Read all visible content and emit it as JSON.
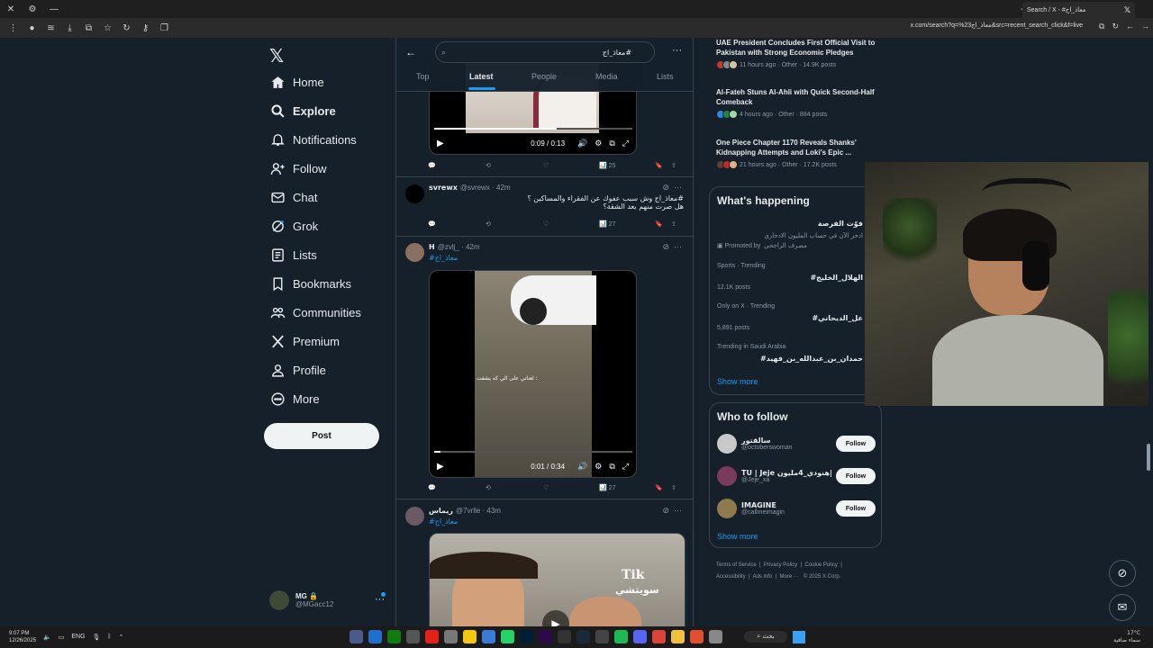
{
  "browser": {
    "tab_title": "Search / X - #معاذ_اج",
    "url": "x.com/search?q=%23معاذ_اج&src=recent_search_click&f=live"
  },
  "nav": {
    "items": [
      {
        "label": "Home"
      },
      {
        "label": "Explore"
      },
      {
        "label": "Notifications"
      },
      {
        "label": "Follow"
      },
      {
        "label": "Chat"
      },
      {
        "label": "Grok"
      },
      {
        "label": "Lists"
      },
      {
        "label": "Bookmarks"
      },
      {
        "label": "Communities"
      },
      {
        "label": "Premium"
      },
      {
        "label": "Profile"
      },
      {
        "label": "More"
      }
    ],
    "post_label": "Post",
    "account": {
      "name": "MG 🔒",
      "handle": "@MGacc12"
    }
  },
  "search": {
    "query": "#معاذ_اج",
    "tabs": [
      "Top",
      "Latest",
      "People",
      "Media",
      "Lists"
    ],
    "active_tab": "Latest"
  },
  "tweets": {
    "t0": {
      "time": "0:09 / 0:13",
      "views": "25"
    },
    "t1": {
      "name": "svrewx",
      "handle": "@svrewx",
      "time": "· 42m",
      "line1": "#معاذ_اج وش سبب عفوك عن الفقراء والمساكين ؟",
      "line2": "هل صرت منهم بعد الشقة؟",
      "views": "27"
    },
    "t2": {
      "name": "H",
      "handle": "@zvlj_",
      "time": "· 42m",
      "text": "#معاذ_اج",
      "video_time": "0:01 / 0:34",
      "video_caption": "لعناتي على الي كه يشفت :",
      "views": "27",
      "video_progress": 0.03
    },
    "t3": {
      "name": "ريماس",
      "handle": "@7vrlle",
      "time": "· 43m",
      "text": "#معاذ_اج",
      "overlay1": "Tik",
      "overlay2": "سويتشي"
    }
  },
  "right": {
    "news": [
      {
        "title": "UAE President Concludes First Official Visit to Pakistan with Strong Economic Pledges",
        "meta": "11 hours ago · Other · 14.9K posts"
      },
      {
        "title": "Al-Fateh Stuns Al-Ahli with Quick Second-Half Comeback",
        "meta": "4 hours ago · Other · 884 posts"
      },
      {
        "title": "One Piece Chapter 1170 Reveals Shanks' Kidnapping Attempts and Loki's Epic ...",
        "meta": "21 hours ago · Other · 17.2K posts"
      }
    ],
    "happening": {
      "title": "What's happening",
      "promo_name": "فوّت الفرصة",
      "promo_sub": "ادخر الآن في حساب المليون الادخاري",
      "promo_by": "Promoted by",
      "promo_brand": "مصرف الراجحي",
      "trends": [
        {
          "context": "Sports · Trending",
          "name": "#الهلال_الخليج",
          "posts": "12.1K posts"
        },
        {
          "context": "Only on X · Trending",
          "name": "#عل_الديحاني",
          "posts": "5,891 posts"
        },
        {
          "context": "Trending in Saudi Arabia",
          "name": "#حمدان_بن_عبدالله_بن_فهيد",
          "posts": ""
        }
      ],
      "show_more": "Show more"
    },
    "who_to_follow": {
      "title": "Who to follow",
      "people": [
        {
          "name": "سالقتور",
          "handle": "@octoberswoman"
        },
        {
          "name": "TU | Jeje هنودي_4مليون|",
          "handle": "@Jeje_xa"
        },
        {
          "name": "IMAGINE",
          "handle": "@callmeimagin"
        }
      ],
      "follow_label": "Follow",
      "show_more": "Show more"
    },
    "footer": [
      "Terms of Service",
      "Privacy Policy",
      "Cookie Policy",
      "Accessibility",
      "Ads info",
      "More ···",
      "© 2025 X Corp."
    ]
  },
  "taskbar": {
    "time": "9:07 PM",
    "date": "12/26/2025",
    "lang": "ENG",
    "search": "بحث",
    "weather_temp": "17°C",
    "weather_desc": "سماء صافية"
  },
  "colors": {
    "bg": "#15202b",
    "accent": "#1d9bf0",
    "border": "#38444d"
  }
}
